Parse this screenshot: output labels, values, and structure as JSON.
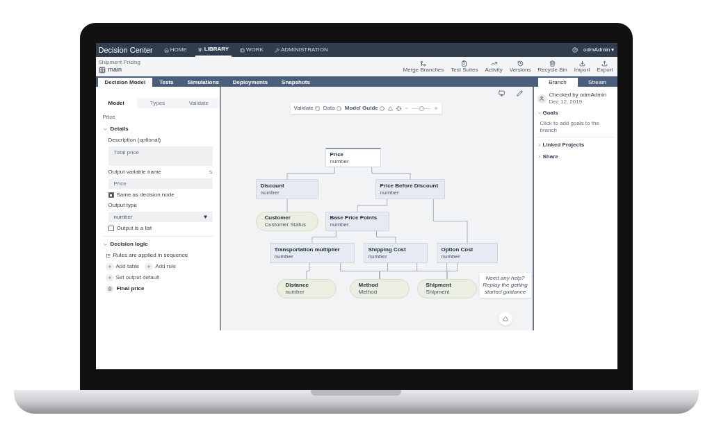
{
  "nav": {
    "brand": "Decision Center",
    "items": [
      {
        "label": "HOME",
        "selected": false
      },
      {
        "label": "LIBRARY",
        "selected": true
      },
      {
        "label": "WORK",
        "selected": false
      },
      {
        "label": "ADMINISTRATION",
        "selected": false
      }
    ],
    "user": "odmAdmin ▾"
  },
  "breadcrumb": "Shipment Pricing",
  "branch": "main",
  "toolbar": [
    {
      "label": "Merge Branches",
      "kind": "merge"
    },
    {
      "label": "Test Suites",
      "kind": "tests"
    },
    {
      "label": "Activity",
      "kind": "activity"
    },
    {
      "label": "Versions",
      "kind": "versions"
    },
    {
      "label": "Recycle Bin",
      "kind": "recycle"
    },
    {
      "label": "Import",
      "kind": "import"
    },
    {
      "label": "Export",
      "kind": "export"
    }
  ],
  "tabs": [
    {
      "label": "Decision Model",
      "selected": true
    },
    {
      "label": "Tests",
      "selected": false
    },
    {
      "label": "Simulations",
      "selected": false
    },
    {
      "label": "Deployments",
      "selected": false
    },
    {
      "label": "Snapshots",
      "selected": false
    }
  ],
  "side_tabs": [
    {
      "label": "Branch",
      "selected": true
    },
    {
      "label": "Stream",
      "selected": false
    }
  ],
  "panel": {
    "tabs": [
      {
        "label": "Model",
        "selected": true
      },
      {
        "label": "Types",
        "selected": false
      },
      {
        "label": "Validate",
        "selected": false
      }
    ],
    "node_name": "Price",
    "details": {
      "title": "Details",
      "expanded": true,
      "description_label": "Description (optional)",
      "description": "Total price",
      "output_label": "Output variable name",
      "output_value": "Price",
      "same_as_node": {
        "label": "Same as decision node",
        "checked": true
      },
      "type_label": "Output type",
      "type_value": "number",
      "is_list": {
        "label": "Output is a list",
        "checked": false
      }
    },
    "logic": {
      "title": "Decision logic",
      "expanded": true,
      "mode": "Rules are applied in sequence",
      "actions": [
        "Add table",
        "Add rule",
        "Set output default"
      ],
      "rule": "Final price"
    }
  },
  "canvas": {
    "toolbar": [
      {
        "label": "Validate",
        "kind": "square"
      },
      {
        "label": "Data",
        "kind": "circle"
      },
      {
        "label": "Model Guide",
        "kind": "circle"
      }
    ],
    "zoom": {
      "level": 0.5
    },
    "nodes": [
      {
        "name": "Price",
        "type": "number",
        "kind": "decision"
      },
      {
        "name": "Discount",
        "type": "number",
        "kind": "decision"
      },
      {
        "name": "Price Before Discount",
        "type": "number",
        "kind": "decision"
      },
      {
        "name": "Customer",
        "type": "Customer Status",
        "kind": "input"
      },
      {
        "name": "Base Price Points",
        "type": "number",
        "kind": "decision"
      },
      {
        "name": "Transportation multiplier",
        "type": "number",
        "kind": "decision"
      },
      {
        "name": "Shipping Cost",
        "type": "number",
        "kind": "decision"
      },
      {
        "name": "Option Cost",
        "type": "number",
        "kind": "decision"
      },
      {
        "name": "Distance",
        "type": "number",
        "kind": "input"
      },
      {
        "name": "Method",
        "type": "Method",
        "kind": "input"
      },
      {
        "name": "Shipment",
        "type": "Shipment",
        "kind": "input"
      }
    ],
    "help": "Need any help? Replay the getting started guidance"
  },
  "info": {
    "checked_by": "Checked by odmAdmin",
    "date": "Dec 12, 2019",
    "sections": [
      {
        "title": "Goals",
        "expanded": true,
        "text": "Click to add goals to the branch"
      },
      {
        "title": "Linked Projects",
        "expanded": false
      },
      {
        "title": "Share",
        "expanded": false
      }
    ]
  }
}
